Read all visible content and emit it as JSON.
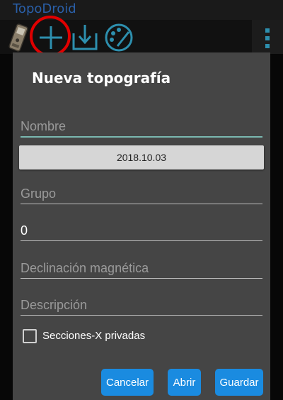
{
  "app": {
    "title": "TopoDroid"
  },
  "toolbar": {
    "icons": [
      "device-icon",
      "add-icon",
      "import-icon",
      "palette-icon",
      "menu-dots-icon"
    ]
  },
  "dialog": {
    "title": "Nueva topografía",
    "fields": {
      "name_placeholder": "Nombre",
      "date": "2018.10.03",
      "group_placeholder": "Grupo",
      "number_value": "0",
      "declination_placeholder": "Declinación magnética",
      "description_placeholder": "Descripción"
    },
    "checkbox": {
      "label": "Secciones-X privadas",
      "checked": false
    },
    "buttons": {
      "cancel": "Cancelar",
      "open": "Abrir",
      "save": "Guardar"
    }
  },
  "colors": {
    "accent": "#1a8be0",
    "dialog_bg": "#454545",
    "focus_underline": "#7ab8b0",
    "highlight": "#e00000"
  }
}
